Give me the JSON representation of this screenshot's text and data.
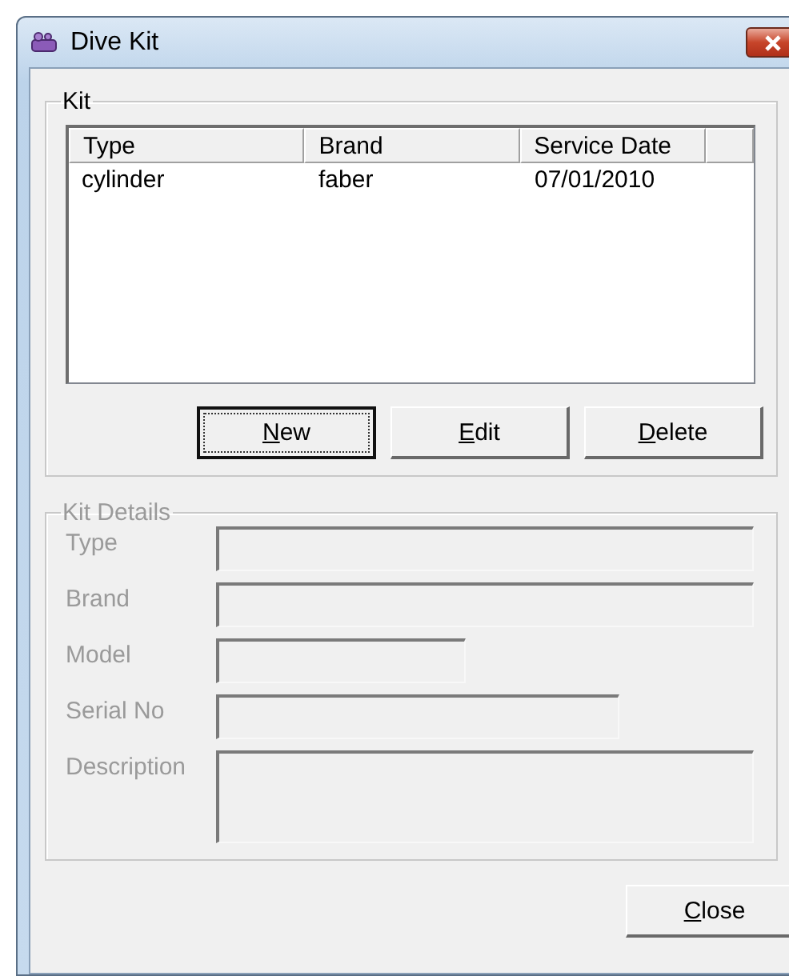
{
  "window": {
    "title": "Dive Kit"
  },
  "kit": {
    "title": "Kit",
    "table": {
      "columns": [
        "Type",
        "Brand",
        "Service Date"
      ],
      "rows": [
        {
          "cells": [
            "cylinder",
            "faber",
            "07/01/2010"
          ],
          "selected": false
        }
      ]
    },
    "buttons": [
      {
        "label": "New",
        "default": true
      },
      {
        "label": "Edit",
        "default": false
      },
      {
        "label": "Delete",
        "default": false
      }
    ]
  },
  "kit_details": {
    "title": "Kit Details",
    "disabled": true,
    "fields": [
      {
        "label": "Type",
        "kind": "line"
      },
      {
        "label": "Brand",
        "kind": "line"
      },
      {
        "label": "Model",
        "kind": "line"
      },
      {
        "label": "Serial No",
        "kind": "line"
      },
      {
        "label": "Description",
        "kind": "multiline"
      }
    ]
  },
  "buttons": [
    {
      "label": "Close",
      "default": false
    }
  ]
}
